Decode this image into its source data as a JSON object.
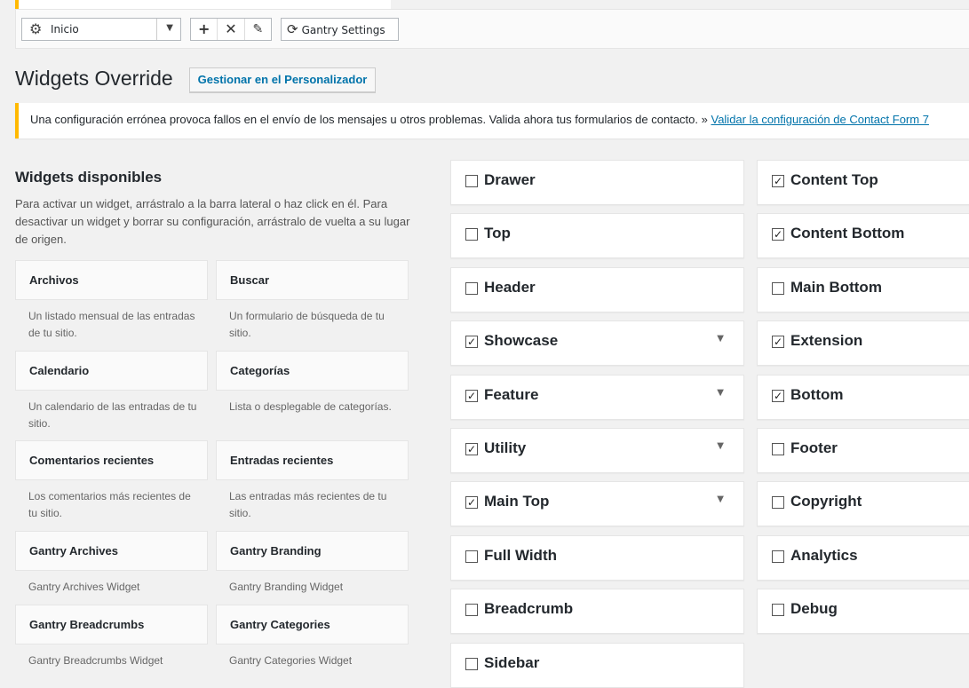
{
  "toolbar": {
    "location_value": "Inicio",
    "add_icon": "+",
    "delete_icon": "✕",
    "edit_icon": "✎",
    "settings_label": "Gantry Settings"
  },
  "header": {
    "title": "Widgets Override",
    "customize_button": "Gestionar en el Personalizador"
  },
  "notice": {
    "text": "Una configuración errónea provoca fallos en el envío de los mensajes u otros problemas. Valida ahora tus formularios de contacto. »",
    "link": "Validar la configuración de Contact Form 7"
  },
  "available": {
    "title": "Widgets disponibles",
    "description": "Para activar un widget, arrástralo a la barra lateral o haz click en él. Para desactivar un widget y borrar su configuración, arrástralo de vuelta a su lugar de origen.",
    "widgets": [
      {
        "name": "Archivos",
        "desc": "Un listado mensual de las entradas de tu sitio."
      },
      {
        "name": "Buscar",
        "desc": "Un formulario de búsqueda de tu sitio."
      },
      {
        "name": "Calendario",
        "desc": "Un calendario de las entradas de tu sitio."
      },
      {
        "name": "Categorías",
        "desc": "Lista o desplegable de categorías."
      },
      {
        "name": "Comentarios recientes",
        "desc": "Los comentarios más recientes de tu sitio."
      },
      {
        "name": "Entradas recientes",
        "desc": "Las entradas más recientes de tu sitio."
      },
      {
        "name": "Gantry Archives",
        "desc": "Gantry Archives Widget"
      },
      {
        "name": "Gantry Branding",
        "desc": "Gantry Branding Widget"
      },
      {
        "name": "Gantry Breadcrumbs",
        "desc": "Gantry Breadcrumbs Widget"
      },
      {
        "name": "Gantry Categories",
        "desc": "Gantry Categories Widget"
      }
    ]
  },
  "sidebars_col1": [
    {
      "label": "Drawer",
      "checked": false,
      "expandable": false
    },
    {
      "label": "Top",
      "checked": false,
      "expandable": false
    },
    {
      "label": "Header",
      "checked": false,
      "expandable": false
    },
    {
      "label": "Showcase",
      "checked": true,
      "expandable": true
    },
    {
      "label": "Feature",
      "checked": true,
      "expandable": true
    },
    {
      "label": "Utility",
      "checked": true,
      "expandable": true
    },
    {
      "label": "Main Top",
      "checked": true,
      "expandable": true
    },
    {
      "label": "Full Width",
      "checked": false,
      "expandable": false
    },
    {
      "label": "Breadcrumb",
      "checked": false,
      "expandable": false
    },
    {
      "label": "Sidebar",
      "checked": false,
      "expandable": false
    }
  ],
  "sidebars_col2": [
    {
      "label": "Content Top",
      "checked": true
    },
    {
      "label": "Content Bottom",
      "checked": true
    },
    {
      "label": "Main Bottom",
      "checked": false
    },
    {
      "label": "Extension",
      "checked": true
    },
    {
      "label": "Bottom",
      "checked": true
    },
    {
      "label": "Footer",
      "checked": false
    },
    {
      "label": "Copyright",
      "checked": false
    },
    {
      "label": "Analytics",
      "checked": false
    },
    {
      "label": "Debug",
      "checked": false
    }
  ]
}
